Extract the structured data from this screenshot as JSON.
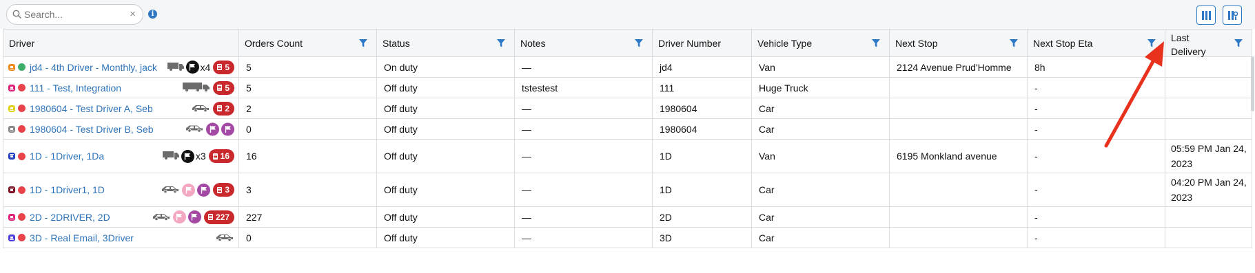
{
  "search": {
    "placeholder": "Search...",
    "value": "",
    "clear_icon": "×"
  },
  "toolbar": {
    "info_icon": "info-icon",
    "columns_icon": "columns-icon",
    "settings_icon": "column-settings-icon",
    "accent": "#2f78c4"
  },
  "columns": [
    {
      "key": "driver",
      "label": "Driver",
      "filter": false
    },
    {
      "key": "orders_count",
      "label": "Orders Count",
      "filter": true
    },
    {
      "key": "status",
      "label": "Status",
      "filter": true
    },
    {
      "key": "notes",
      "label": "Notes",
      "filter": true
    },
    {
      "key": "driver_number",
      "label": "Driver Number",
      "filter": true
    },
    {
      "key": "vehicle_type",
      "label": "Vehicle Type",
      "filter": true
    },
    {
      "key": "next_stop",
      "label": "Next Stop",
      "filter": true
    },
    {
      "key": "next_stop_eta",
      "label": "Next Stop Eta",
      "filter": true
    },
    {
      "key": "last_delivery",
      "label": "Last Delivery",
      "filter": true
    }
  ],
  "rows": [
    {
      "name": "jd4 - 4th Driver - Monthly, jack",
      "badge_color": "#f08a1e",
      "status_dot": "#3dae6b",
      "vehicle": "van",
      "flags": [
        {
          "color": "#111111"
        }
      ],
      "multiplier": "x4",
      "orders_badge": "5",
      "orders_count": "5",
      "status": "On duty",
      "notes": "—",
      "driver_number": "jd4",
      "vehicle_type": "Van",
      "next_stop": "2124 Avenue Prud'Homme",
      "next_stop_eta": "8h",
      "last_delivery": ""
    },
    {
      "name": "111 - Test, Integration",
      "badge_color": "#e0217a",
      "status_dot": "#e8424a",
      "vehicle": "truck",
      "flags": [],
      "multiplier": "",
      "orders_badge": "5",
      "orders_count": "5",
      "status": "Off duty",
      "notes": "tstestest",
      "driver_number": "111",
      "vehicle_type": "Huge Truck",
      "next_stop": "",
      "next_stop_eta": "-",
      "last_delivery": ""
    },
    {
      "name": "1980604 - Test Driver A, Seb",
      "badge_color": "#e3d21a",
      "status_dot": "#e8424a",
      "vehicle": "car",
      "flags": [],
      "multiplier": "",
      "orders_badge": "2",
      "orders_count": "2",
      "status": "Off duty",
      "notes": "—",
      "driver_number": "1980604",
      "vehicle_type": "Car",
      "next_stop": "",
      "next_stop_eta": "-",
      "last_delivery": ""
    },
    {
      "name": "1980604 - Test Driver B, Seb",
      "badge_color": "#888888",
      "status_dot": "#e8424a",
      "vehicle": "car",
      "flags": [
        {
          "color": "#a349a4"
        },
        {
          "color": "#a349a4"
        }
      ],
      "multiplier": "",
      "orders_badge": "",
      "orders_count": "0",
      "status": "Off duty",
      "notes": "—",
      "driver_number": "1980604",
      "vehicle_type": "Car",
      "next_stop": "",
      "next_stop_eta": "-",
      "last_delivery": ""
    },
    {
      "name": "1D - 1Driver, 1Da",
      "badge_color": "#1f3fbf",
      "status_dot": "#e8424a",
      "vehicle": "van",
      "flags": [
        {
          "color": "#111111"
        }
      ],
      "multiplier": "x3",
      "orders_badge": "16",
      "orders_count": "16",
      "status": "Off duty",
      "notes": "—",
      "driver_number": "1D",
      "vehicle_type": "Van",
      "next_stop": "6195 Monkland avenue",
      "next_stop_eta": "-",
      "last_delivery": "05:59 PM Jan 24, 2023"
    },
    {
      "name": "1D - 1Driver1, 1D",
      "badge_color": "#7a1020",
      "status_dot": "#e8424a",
      "vehicle": "car",
      "flags": [
        {
          "color": "#f3a7c0"
        },
        {
          "color": "#a349a4"
        }
      ],
      "multiplier": "",
      "orders_badge": "3",
      "orders_count": "3",
      "status": "Off duty",
      "notes": "—",
      "driver_number": "1D",
      "vehicle_type": "Car",
      "next_stop": "",
      "next_stop_eta": "-",
      "last_delivery": "04:20 PM Jan 24, 2023"
    },
    {
      "name": "2D - 2DRIVER, 2D",
      "badge_color": "#e0217a",
      "status_dot": "#e8424a",
      "vehicle": "car",
      "flags": [
        {
          "color": "#f3a7c0"
        },
        {
          "color": "#a349a4"
        }
      ],
      "multiplier": "",
      "orders_badge": "227",
      "orders_count": "227",
      "status": "Off duty",
      "notes": "—",
      "driver_number": "2D",
      "vehicle_type": "Car",
      "next_stop": "",
      "next_stop_eta": "-",
      "last_delivery": ""
    },
    {
      "name": "3D - Real Email, 3Driver",
      "badge_color": "#4b3fd8",
      "status_dot": "#e8424a",
      "vehicle": "car",
      "flags": [],
      "multiplier": "",
      "orders_badge": "",
      "orders_count": "0",
      "status": "Off duty",
      "notes": "—",
      "driver_number": "3D",
      "vehicle_type": "Car",
      "next_stop": "",
      "next_stop_eta": "-",
      "last_delivery": ""
    }
  ],
  "annotation": {
    "type": "arrow",
    "color": "#e8321e",
    "points_to": "Last Delivery"
  }
}
